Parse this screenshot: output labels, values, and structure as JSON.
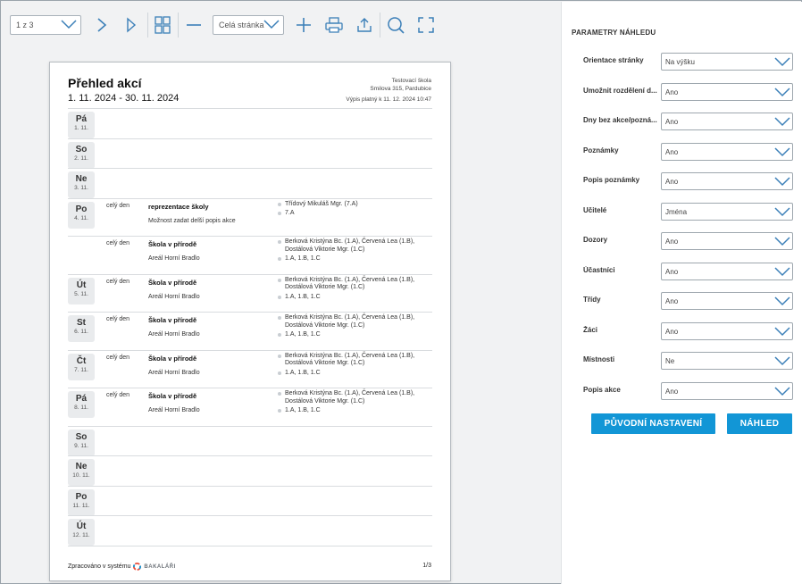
{
  "toolbar": {
    "page_select": "1 z 3",
    "zoom_select": "Celá stránka"
  },
  "doc": {
    "title": "Přehled akcí",
    "range": "1. 11. 2024 - 30. 11. 2024",
    "school_name": "Testovací škola",
    "school_address": "Smilova 315, Pardubice",
    "valid": "Výpis platný k 11. 12. 2024 10:47",
    "footer_text": "Zpracováno v systému",
    "footer_brand": "BAKALÁŘI",
    "pages": "1/3",
    "rows": [
      {
        "day": "Pá",
        "date": "1. 11.",
        "events": []
      },
      {
        "day": "So",
        "date": "2. 11.",
        "events": []
      },
      {
        "day": "Ne",
        "date": "3. 11.",
        "events": []
      },
      {
        "day": "Po",
        "date": "4. 11.",
        "events": [
          {
            "time": "celý den",
            "name": "reprezentace školy",
            "desc": "Možnost zadat delší popis akce",
            "teachers": "Třídový Mikuláš Mgr. (7.A)",
            "classes": "7.A"
          },
          {
            "time": "celý den",
            "name": "Škola v přírodě",
            "desc": "Areál Horní Bradlo",
            "teachers": "Berková Kristýna Bc. (1.A), Červená Lea (1.B), Dostálová Viktorie Mgr. (1.C)",
            "classes": "1.A, 1.B, 1.C"
          }
        ]
      },
      {
        "day": "Út",
        "date": "5. 11.",
        "events": [
          {
            "time": "celý den",
            "name": "Škola v přírodě",
            "desc": "Areál Horní Bradlo",
            "teachers": "Berková Kristýna Bc. (1.A), Červená Lea (1.B), Dostálová Viktorie Mgr. (1.C)",
            "classes": "1.A, 1.B, 1.C"
          }
        ]
      },
      {
        "day": "St",
        "date": "6. 11.",
        "events": [
          {
            "time": "celý den",
            "name": "Škola v přírodě",
            "desc": "Areál Horní Bradlo",
            "teachers": "Berková Kristýna Bc. (1.A), Červená Lea (1.B), Dostálová Viktorie Mgr. (1.C)",
            "classes": "1.A, 1.B, 1.C"
          }
        ]
      },
      {
        "day": "Čt",
        "date": "7. 11.",
        "events": [
          {
            "time": "celý den",
            "name": "Škola v přírodě",
            "desc": "Areál Horní Bradlo",
            "teachers": "Berková Kristýna Bc. (1.A), Červená Lea (1.B), Dostálová Viktorie Mgr. (1.C)",
            "classes": "1.A, 1.B, 1.C"
          }
        ]
      },
      {
        "day": "Pá",
        "date": "8. 11.",
        "events": [
          {
            "time": "celý den",
            "name": "Škola v přírodě",
            "desc": "Areál Horní Bradlo",
            "teachers": "Berková Kristýna Bc. (1.A), Červená Lea (1.B), Dostálová Viktorie Mgr. (1.C)",
            "classes": "1.A, 1.B, 1.C"
          }
        ]
      },
      {
        "day": "So",
        "date": "9. 11.",
        "events": []
      },
      {
        "day": "Ne",
        "date": "10. 11.",
        "events": []
      },
      {
        "day": "Po",
        "date": "11. 11.",
        "events": []
      },
      {
        "day": "Út",
        "date": "12. 11.",
        "events": []
      }
    ]
  },
  "panel": {
    "title": "PARAMETRY NÁHLEDU",
    "params": [
      {
        "label": "Orientace stránky",
        "value": "Na výšku"
      },
      {
        "label": "Umožnit rozdělení d...",
        "value": "Ano"
      },
      {
        "label": "Dny bez akce/pozná...",
        "value": "Ano"
      },
      {
        "label": "Poznámky",
        "value": "Ano"
      },
      {
        "label": "Popis poznámky",
        "value": "Ano"
      },
      {
        "label": "Učitelé",
        "value": "Jména"
      },
      {
        "label": "Dozory",
        "value": "Ano"
      },
      {
        "label": "Účastníci",
        "value": "Ano"
      },
      {
        "label": "Třídy",
        "value": "Ano"
      },
      {
        "label": "Žáci",
        "value": "Ano"
      },
      {
        "label": "Místnosti",
        "value": "Ne"
      },
      {
        "label": "Popis akce",
        "value": "Ano"
      }
    ],
    "reset_label": "PŮVODNÍ NASTAVENÍ",
    "preview_label": "NÁHLED",
    "accent": "#1296d6"
  }
}
